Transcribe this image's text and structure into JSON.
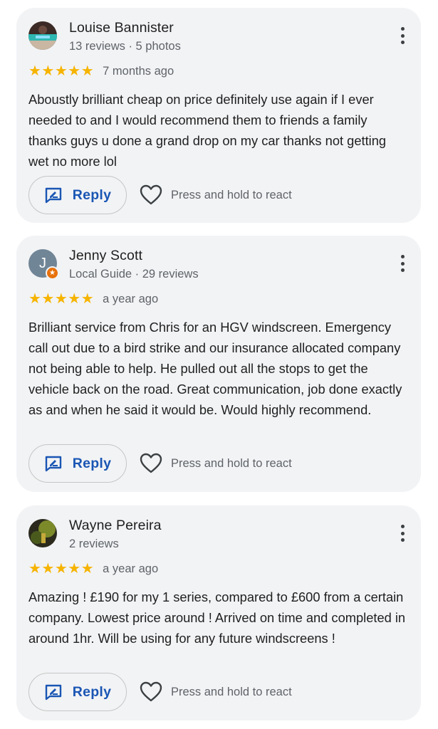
{
  "reviews": [
    {
      "name": "Louise Bannister",
      "meta": "13 reviews · 5 photos",
      "stars": "★★★★★",
      "rating": 5,
      "date": "7 months ago",
      "text": "Aboustly brilliant cheap on price definitely use again if I ever needed to and I would recommend them to friends a family thanks guys u done a grand drop on my car thanks not getting wet no more lol",
      "reply_label": "Reply",
      "react_label": "Press and hold to react"
    },
    {
      "name": "Jenny Scott",
      "avatar_letter": "J",
      "meta": "Local Guide · 29 reviews",
      "stars": "★★★★★",
      "rating": 5,
      "date": "a year ago",
      "text": "Brilliant service from Chris for an HGV windscreen. Emergency call out due to a bird strike and our insurance allocated company not being able to help. He pulled out all the stops to get the vehicle back on the road. Great communication, job done exactly as and when he said it would be. Would highly recommend.",
      "reply_label": "Reply",
      "react_label": "Press and hold to react"
    },
    {
      "name": "Wayne Pereira",
      "meta": "2 reviews",
      "stars": "★★★★★",
      "rating": 5,
      "date": "a year ago",
      "text": "Amazing ! £190 for my 1 series, compared to £600 from a certain company. Lowest price around ! Arrived on time and completed in around 1hr. Will be using for any future windscreens !",
      "reply_label": "Reply",
      "react_label": "Press and hold to react"
    }
  ],
  "icons": {
    "more": "more-vert-icon",
    "reply": "reply-edit-icon",
    "react": "heart-outline-icon",
    "guide": "local-guide-star-icon"
  },
  "colors": {
    "star": "#f6b400",
    "reply_text": "#1a56b4",
    "card_bg": "#f2f3f5"
  }
}
